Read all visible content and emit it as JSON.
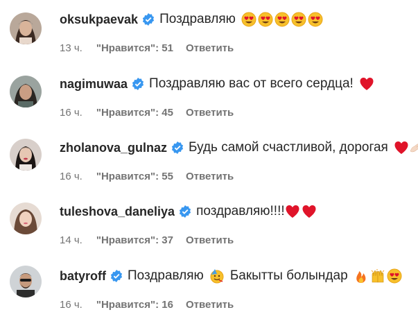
{
  "comments": [
    {
      "username": "oksukpaevak",
      "text": "Поздравляю",
      "emojis": [
        "heart-eyes",
        "heart-eyes",
        "heart-eyes",
        "heart-eyes",
        "heart-eyes"
      ],
      "time": "13 ч.",
      "likes": "\"Нравится\": 51",
      "reply": "Ответить"
    },
    {
      "username": "nagimuwaa",
      "text": "Поздравляю вас от всего сердца!",
      "emojis": [
        "red-heart"
      ],
      "time": "16 ч.",
      "likes": "\"Нравится\": 45",
      "reply": "Ответить"
    },
    {
      "username": "zholanova_gulnaz",
      "text": "Будь самой счастливой, дорогая",
      "emojis": [
        "red-heart",
        "hand"
      ],
      "time": "16 ч.",
      "likes": "\"Нравится\": 55",
      "reply": "Ответить"
    },
    {
      "username": "tuleshova_daneliya",
      "text": "поздравляю!!!!",
      "emojis": [
        "red-heart",
        "red-heart"
      ],
      "time": "14 ч.",
      "likes": "\"Нравится\": 37",
      "reply": "Ответить"
    },
    {
      "username": "batyroff",
      "text": "Поздравляю",
      "text2": "Бакытты болындар",
      "emojis": [
        "party-face"
      ],
      "emojis2": [
        "fire",
        "raised-hands",
        "heart-eyes"
      ],
      "time": "16 ч.",
      "likes": "\"Нравится\": 16",
      "reply": "Ответить"
    }
  ],
  "colors": {
    "verified_badge": "#3897f0",
    "username": "#262626",
    "meta": "#737373",
    "heart": "#e0142a"
  }
}
